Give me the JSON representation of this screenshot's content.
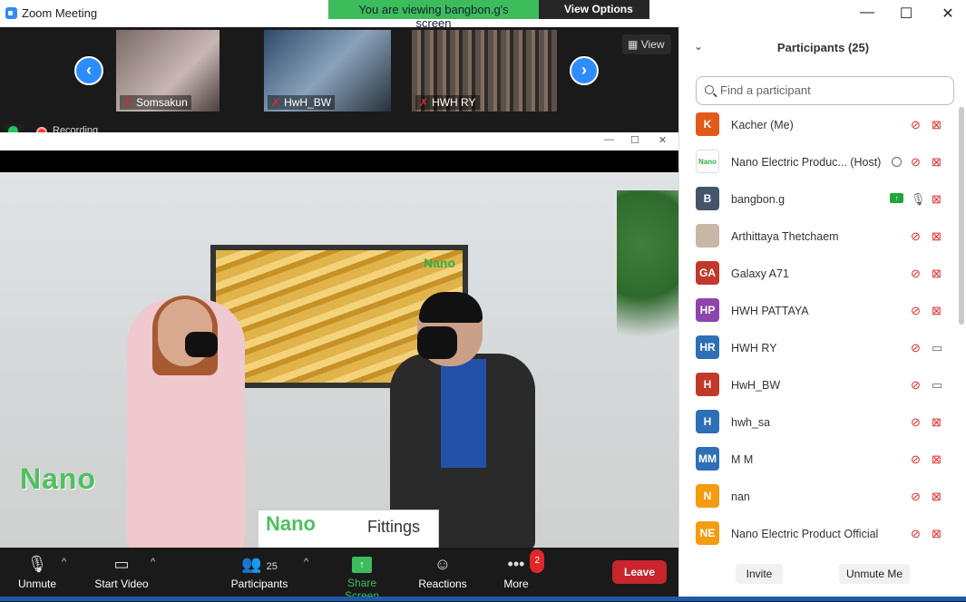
{
  "window": {
    "title": "Zoom Meeting",
    "share_banner": "You are viewing bangbon.g's screen",
    "view_options": "View Options",
    "minimize": "—",
    "maximize": "☐",
    "close": "✕"
  },
  "strip": {
    "view_label": "View",
    "tiles": [
      {
        "name": "Somsakun",
        "muted": true
      },
      {
        "name": "HwH_BW",
        "muted": true
      },
      {
        "name": "HWH RY",
        "muted": true
      }
    ],
    "recording_label": "Recording"
  },
  "shared_screen": {
    "tv_brand": "Nano",
    "sign_brand": "Nano",
    "sign_word": "Fittings",
    "wall_brand": "Nano"
  },
  "toolbar": {
    "unmute": "Unmute",
    "start_video": "Start Video",
    "participants": "Participants",
    "participants_count": "25",
    "share_screen": "Share Screen",
    "reactions": "Reactions",
    "more": "More",
    "more_badge": "2",
    "leave": "Leave"
  },
  "panel": {
    "title": "Participants (25)",
    "search_placeholder": "Find a participant",
    "participants": [
      {
        "initials": "K",
        "color": "#e05a1a",
        "name": "Kacher (Me)",
        "mic": "muted",
        "cam": "off"
      },
      {
        "initials": "Nano",
        "color": "#ffffff",
        "name": "Nano Electric Produc... (Host)",
        "mic": "muted",
        "cam": "off",
        "host": true
      },
      {
        "initials": "B",
        "color": "#44546a",
        "name": "bangbon.g",
        "mic": "on",
        "cam": "off",
        "sharing": true
      },
      {
        "initials": "",
        "color": "#c9b7a5",
        "name": "Arthittaya Thetchaem",
        "mic": "muted",
        "cam": "off"
      },
      {
        "initials": "GA",
        "color": "#c0392b",
        "name": "Galaxy A71",
        "mic": "muted",
        "cam": "off"
      },
      {
        "initials": "HP",
        "color": "#8e44ad",
        "name": "HWH PATTAYA",
        "mic": "muted",
        "cam": "off"
      },
      {
        "initials": "HR",
        "color": "#2e6fb5",
        "name": "HWH RY",
        "mic": "muted",
        "cam": "on"
      },
      {
        "initials": "H",
        "color": "#c0392b",
        "name": "HwH_BW",
        "mic": "muted",
        "cam": "on"
      },
      {
        "initials": "H",
        "color": "#2e6fb5",
        "name": "hwh_sa",
        "mic": "muted",
        "cam": "off"
      },
      {
        "initials": "MM",
        "color": "#2e6fb5",
        "name": "M M",
        "mic": "muted",
        "cam": "off"
      },
      {
        "initials": "N",
        "color": "#f39c12",
        "name": "nan",
        "mic": "muted",
        "cam": "off"
      },
      {
        "initials": "NE",
        "color": "#f39c12",
        "name": "Nano Electric Product Official",
        "mic": "muted",
        "cam": "off"
      }
    ],
    "invite": "Invite",
    "unmute_me": "Unmute Me"
  }
}
